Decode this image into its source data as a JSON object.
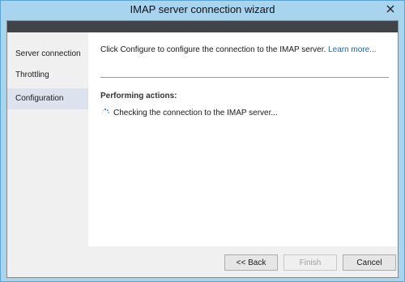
{
  "window": {
    "title": "IMAP server connection wizard"
  },
  "sidebar": {
    "items": [
      {
        "label": "Server connection",
        "selected": false
      },
      {
        "label": "Throttling",
        "selected": false
      },
      {
        "label": "Configuration",
        "selected": true
      }
    ]
  },
  "content": {
    "intro_text": "Click Configure to configure the connection to the IMAP server.",
    "learn_more": "Learn more...",
    "performing_heading": "Performing actions:",
    "action_text": "Checking the connection to the IMAP server..."
  },
  "footer": {
    "back_label": "<< Back",
    "finish_label": "Finish",
    "cancel_label": "Cancel"
  },
  "colors": {
    "accent": "#1a67b7",
    "title_band": "#404448",
    "window_frame": "#a8d4ee",
    "selected_nav": "#dce3ee"
  },
  "icons": {
    "close": "close-icon",
    "spinner": "spinner-icon"
  }
}
